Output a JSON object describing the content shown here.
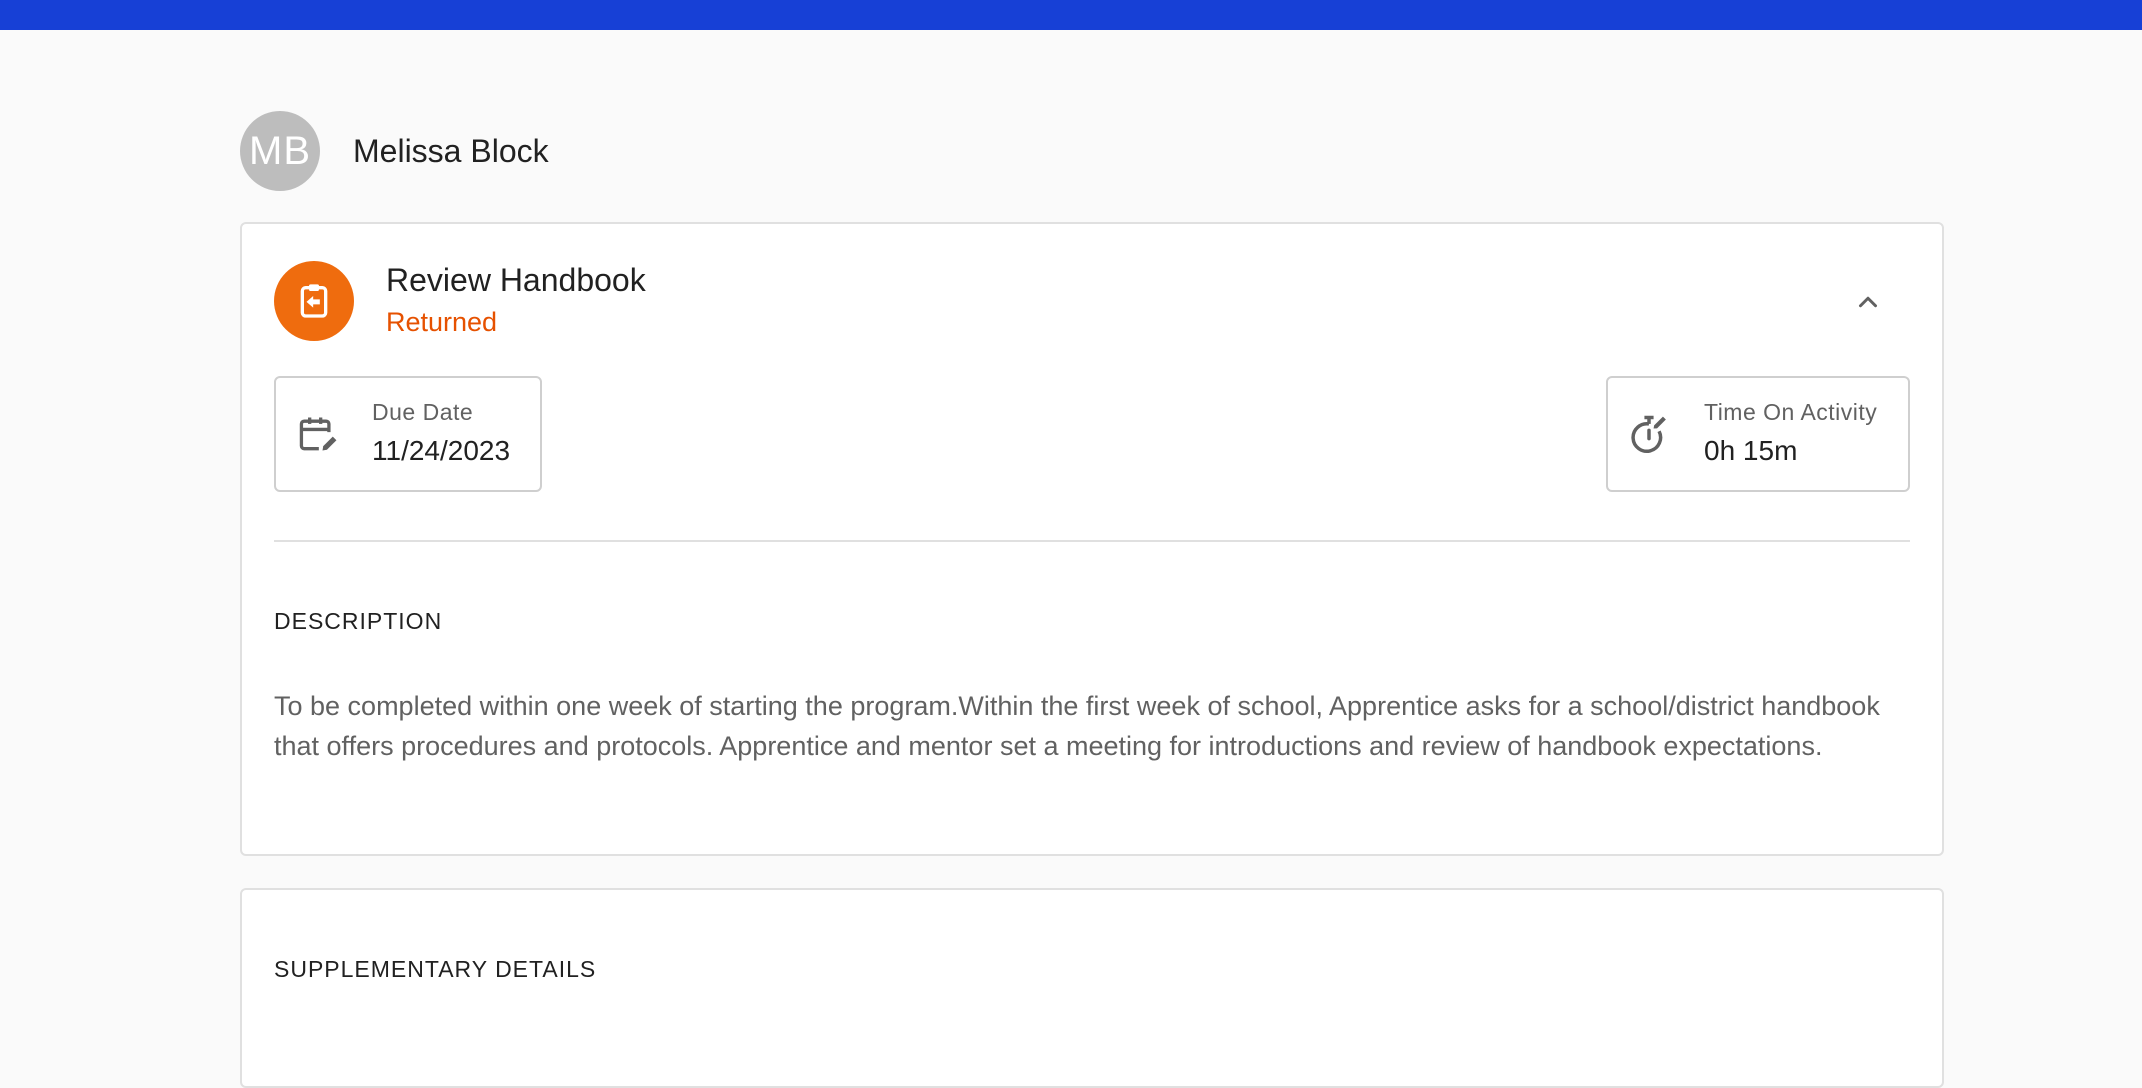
{
  "user": {
    "initials": "MB",
    "name": "Melissa Block"
  },
  "activity": {
    "title": "Review Handbook",
    "status": "Returned",
    "icon": "assignment-return-icon",
    "collapse_icon": "chevron-up-icon"
  },
  "due_date": {
    "label": "Due Date",
    "value": "11/24/2023",
    "icon": "calendar-edit-icon"
  },
  "time_on_activity": {
    "label": "Time On Activity",
    "value": "0h 15m",
    "icon": "timer-edit-icon"
  },
  "description": {
    "heading": "DESCRIPTION",
    "body": "To be completed within one week of starting the program.Within the first week of school, Apprentice asks for a school/district handbook that offers procedures and protocols. Apprentice and mentor set a meeting for introductions and review of handbook expectations."
  },
  "supplementary": {
    "heading": "SUPPLEMENTARY DETAILS"
  },
  "colors": {
    "topbar": "#1740d6",
    "accent_orange": "#ef6c0e",
    "status_orange": "#e65100",
    "avatar_bg": "#bdbdbd"
  }
}
